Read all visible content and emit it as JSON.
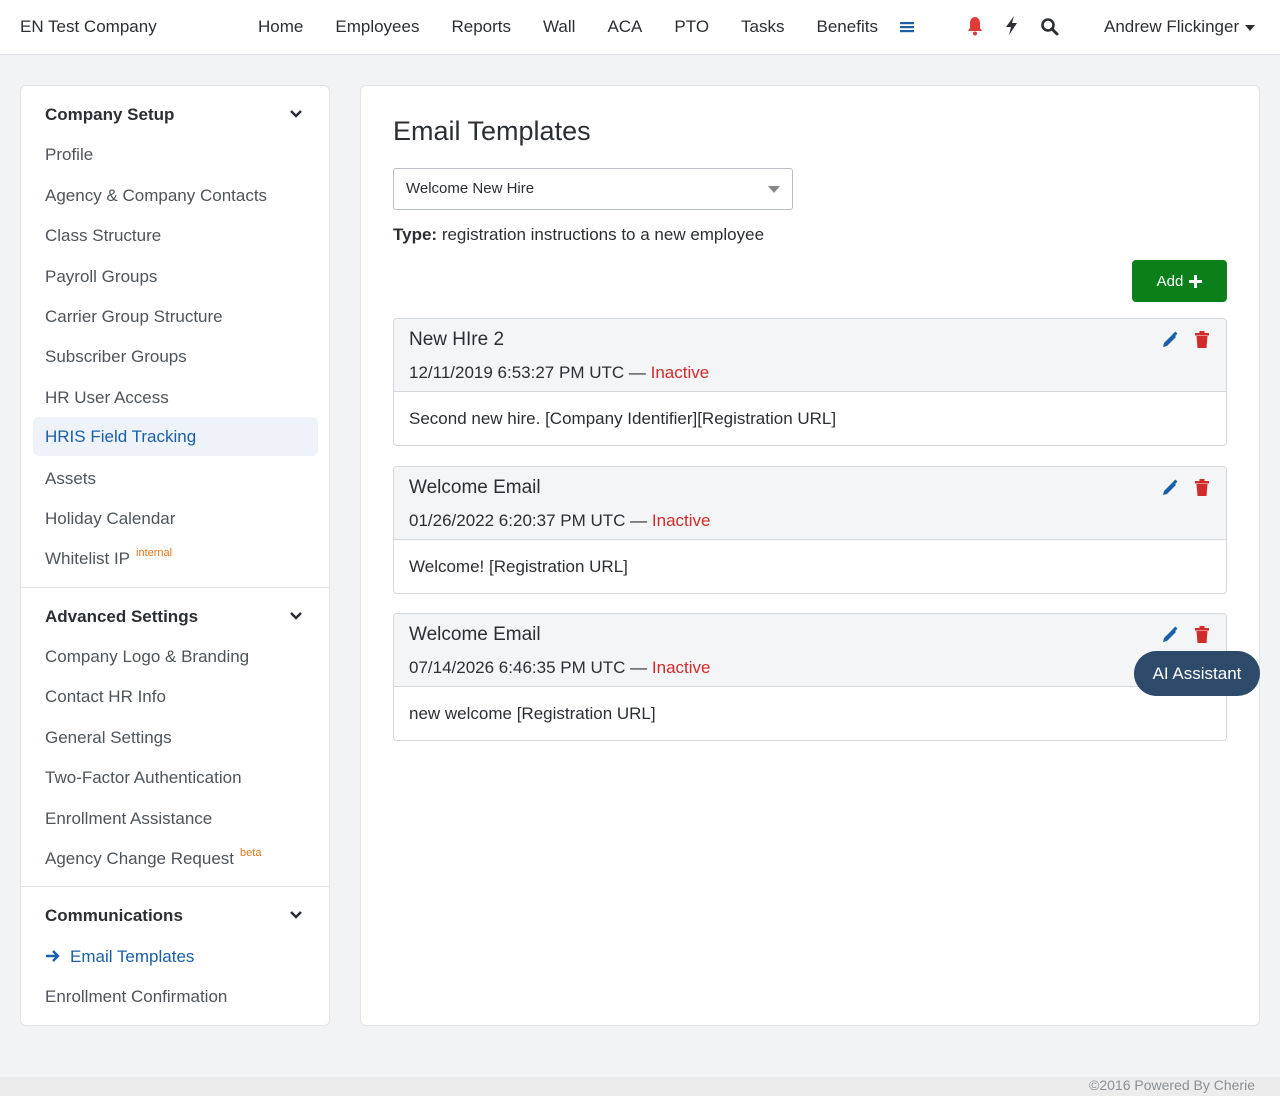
{
  "header": {
    "brand": "EN Test Company",
    "nav": [
      "Home",
      "Employees",
      "Reports",
      "Wall",
      "ACA",
      "PTO",
      "Tasks",
      "Benefits"
    ],
    "icons": [
      "menu-icon",
      "bell-icon",
      "bolt-icon",
      "search-icon"
    ],
    "user": "Andrew Flickinger"
  },
  "sidebar": {
    "company_setup": {
      "title": "Company Setup",
      "items": [
        "Profile",
        "Agency & Company Contacts",
        "Class Structure",
        "Payroll Groups",
        "Carrier Group Structure",
        "Subscriber Groups",
        "HR User Access",
        "HRIS Field Tracking",
        "Assets",
        "Holiday Calendar",
        "Whitelist IP"
      ],
      "whitelist_badge": "internal"
    },
    "advanced_settings": {
      "title": "Advanced Settings",
      "items": [
        "Company Logo & Branding",
        "Contact HR Info",
        "General Settings",
        "Two-Factor Authentication",
        "Enrollment Assistance",
        "Agency Change Request"
      ],
      "agency_badge": "beta"
    },
    "communications": {
      "title": "Communications",
      "items": [
        "Email Templates",
        "Enrollment Confirmation"
      ]
    }
  },
  "main": {
    "title": "Email Templates",
    "select_value": "Welcome New Hire",
    "type_label": "Type:",
    "type_value": "registration instructions to a new employee",
    "add_label": "Add",
    "templates": [
      {
        "name": "New HIre 2",
        "date": "12/11/2019 6:53:27 PM UTC",
        "sep": "—",
        "status": "Inactive",
        "body": "Second new hire. [Company Identifier][Registration URL]"
      },
      {
        "name": "Welcome Email",
        "date": "01/26/2022 6:20:37 PM UTC",
        "sep": "—",
        "status": "Inactive",
        "body": "Welcome! [Registration URL]"
      },
      {
        "name": "Welcome Email",
        "date": "07/14/2026 6:46:35 PM UTC",
        "sep": "—",
        "status": "Inactive",
        "body": "new welcome [Registration URL]"
      }
    ]
  },
  "ai_assistant": "AI Assistant",
  "footer": "©2016 Powered By Cherie",
  "colors": {
    "accent_blue": "#1a5fa8",
    "add_green": "#0b7f1a",
    "danger_red": "#d12b2b",
    "ai_navy": "#2e4a6b"
  }
}
